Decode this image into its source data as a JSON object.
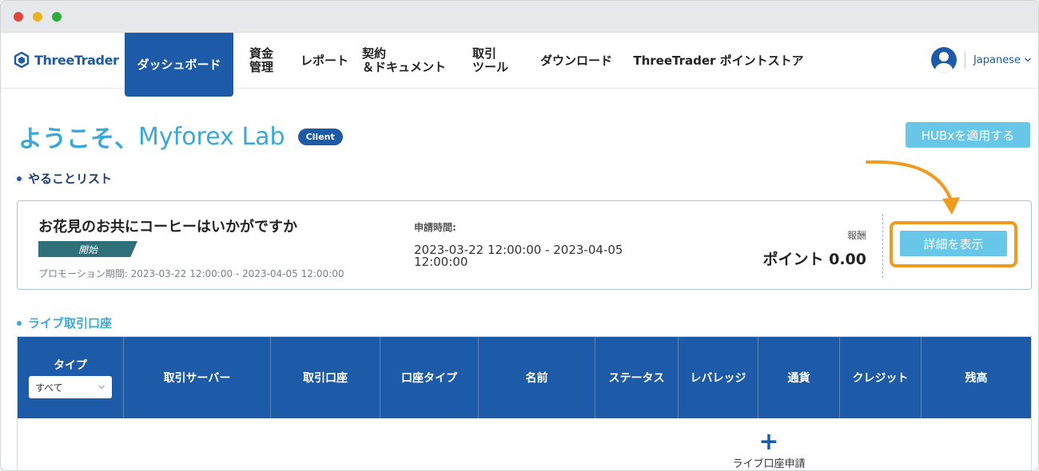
{
  "brand": {
    "name": "ThreeTrader",
    "color": "#1d5ba9"
  },
  "nav": {
    "items": [
      {
        "line1": "ダッシュボード",
        "line2": "",
        "active": true
      },
      {
        "line1": "資金",
        "line2": "管理",
        "active": false
      },
      {
        "line1": "レポート",
        "line2": "",
        "active": false
      },
      {
        "line1": "契約",
        "line2": "＆ドキュメント",
        "active": false
      },
      {
        "line1": "取引",
        "line2": "ツール",
        "active": false
      },
      {
        "line1": "ダウンロード",
        "line2": "",
        "active": false
      },
      {
        "line1": "ThreeTrader ポイントストア",
        "line2": "",
        "active": false
      }
    ],
    "language": "Japanese",
    "avatar_icon": "user-avatar-icon",
    "chevron_icon": "chevron-down-icon"
  },
  "welcome": {
    "greeting": "ようこそ、",
    "name": "Myforex Lab",
    "badge": "Client"
  },
  "hubx_button": "HUBxを適用する",
  "todo": {
    "title": "やることリスト",
    "promo": {
      "title": "お花見のお共にコーヒーはいかがですか",
      "tag": "開始",
      "period_label": "プロモーション期間:",
      "period": "2023-03-22 12:00:00 - 2023-04-05 12:00:00",
      "request_label": "申請時間:",
      "request_value": "2023-03-22 12:00:00 - 2023-04-05 12:00:00",
      "reward_label": "報酬",
      "reward_value": "ポイント 0.00",
      "detail_button": "詳細を表示"
    },
    "highlight_color": "#f29a1e"
  },
  "live_accounts": {
    "title": "ライブ取引口座",
    "columns": [
      {
        "label": "タイプ"
      },
      {
        "label": "取引サーバー"
      },
      {
        "label": "取引口座"
      },
      {
        "label": "口座タイプ"
      },
      {
        "label": "名前"
      },
      {
        "label": "ステータス"
      },
      {
        "label": "レバレッジ"
      },
      {
        "label": "通貨"
      },
      {
        "label": "クレジット"
      },
      {
        "label": "残高"
      }
    ],
    "type_filter": "すべて",
    "add_label": "ライブ口座申請"
  }
}
